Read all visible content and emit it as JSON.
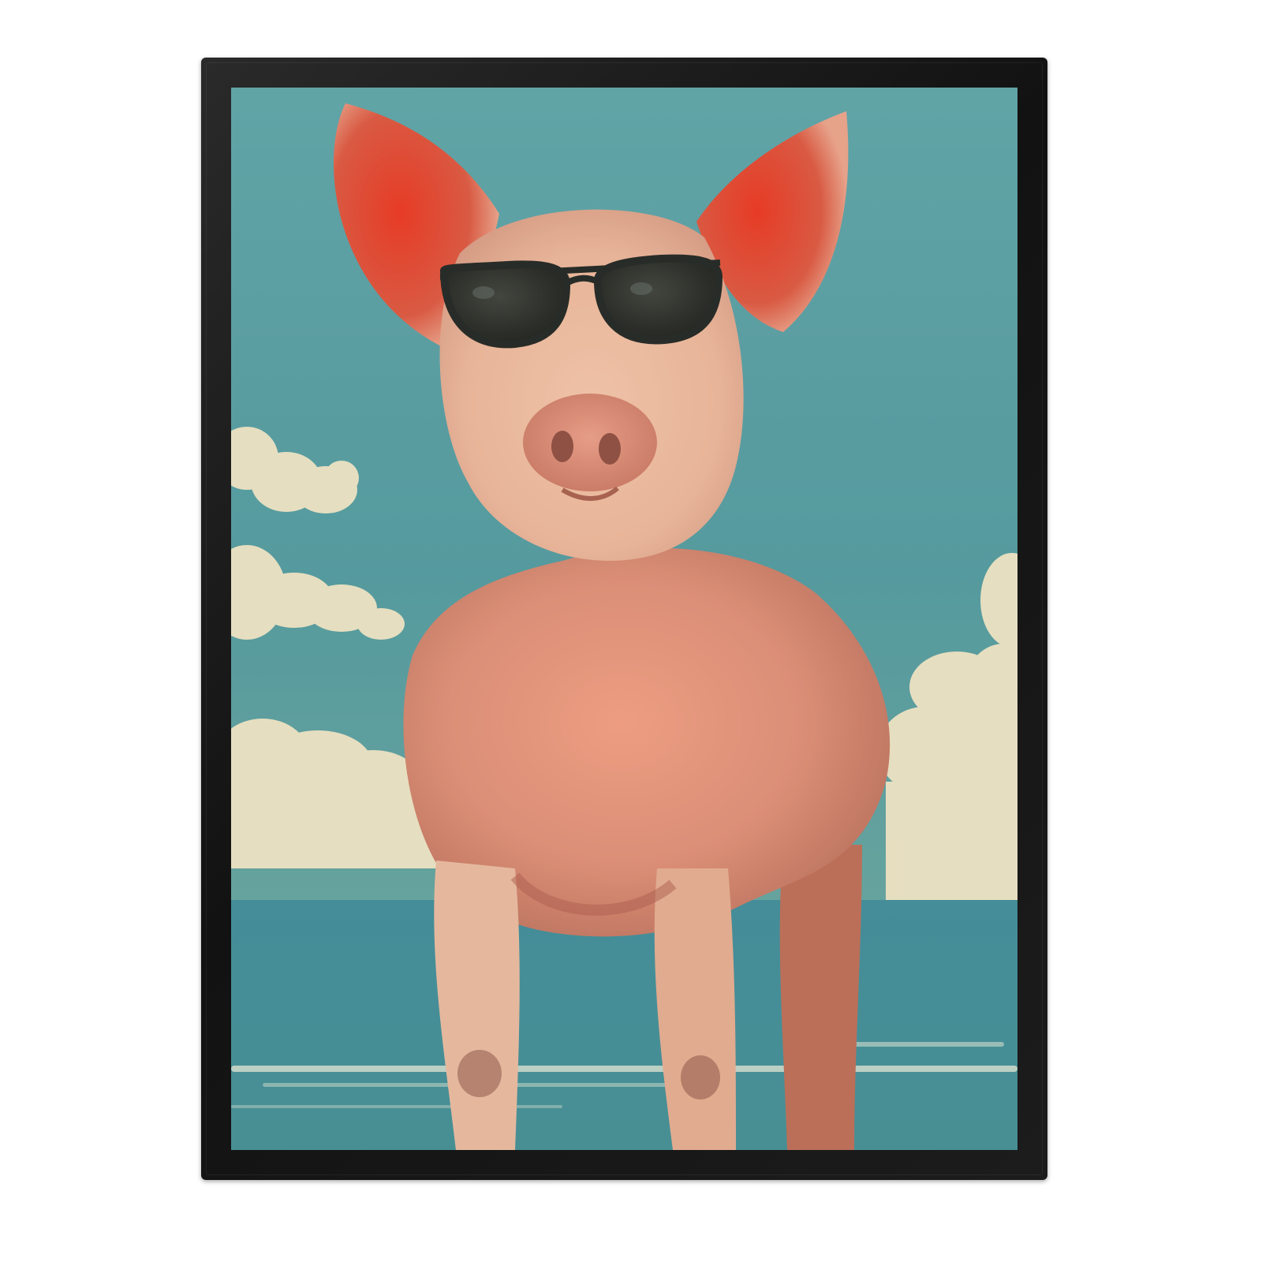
{
  "image": {
    "frame_color": "#161616",
    "sky_color": "#4f9aa1",
    "sea_color": "#3f8a97",
    "cloud_color": "#f0e6c8",
    "pig_body_color": "#e7a38c",
    "pig_shadow_color": "#c96a52",
    "ear_inner_color": "#e0412e",
    "sunglasses_color": "#1d2321"
  }
}
